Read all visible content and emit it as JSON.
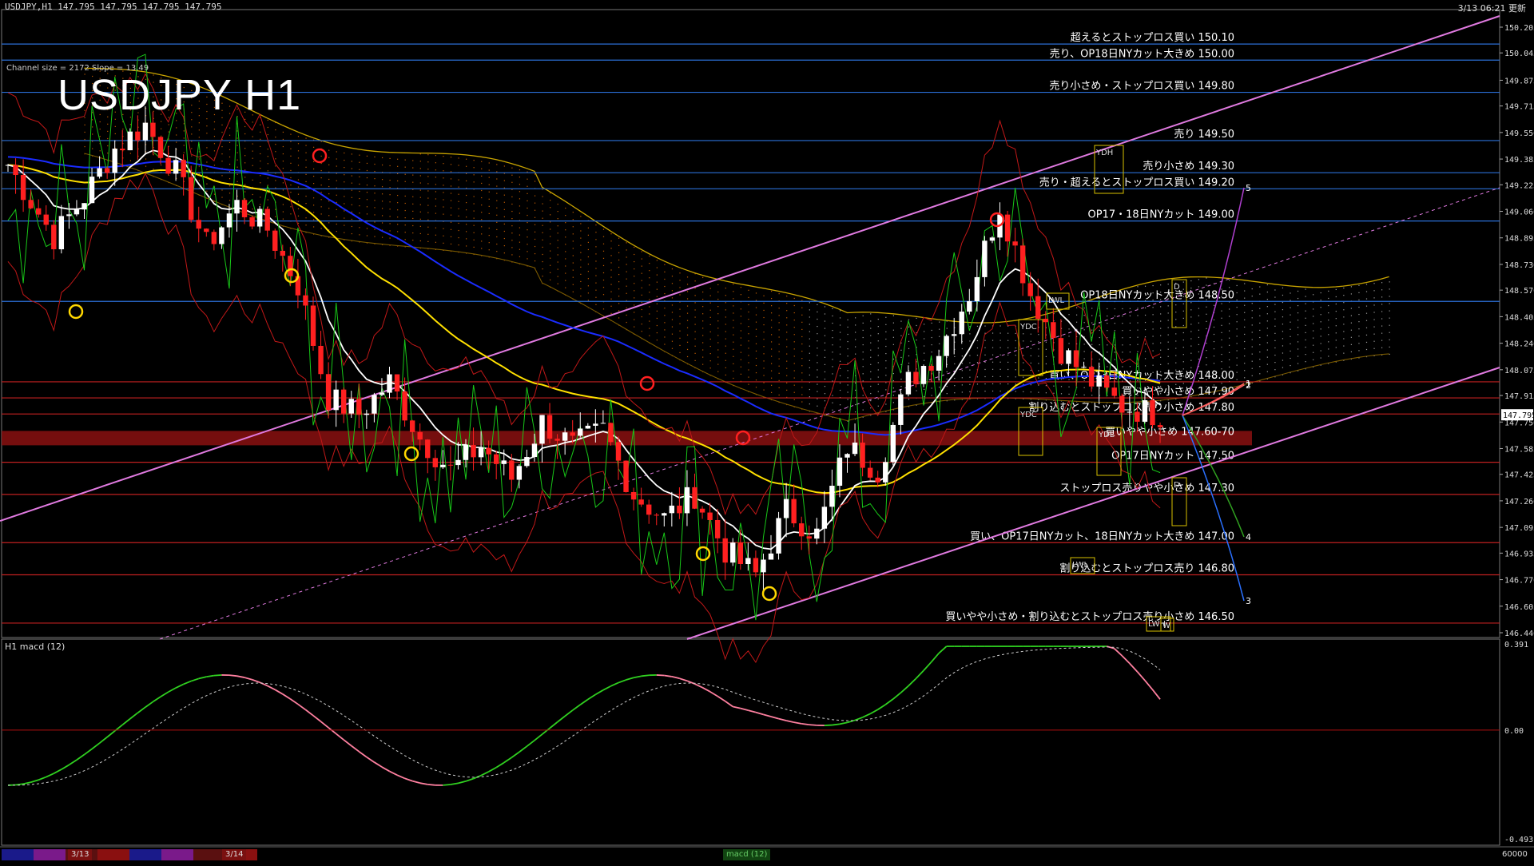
{
  "header": {
    "symbol_line": "USDJPY,H1  147.795 147.795 147.795 147.795",
    "time_line": "3/13 06:21 更新",
    "big_title": "USDJPY H1",
    "channel_info": "Channel size = 2172  Slope = 13.49",
    "macd_title": "H1  macd (12)"
  },
  "colors": {
    "background": "#000000",
    "candle_up": "#ffffff",
    "candle_down": "#ff2020",
    "blue_lines": "#2b6fd6",
    "red_lines": "#c02020",
    "channel": "#e07ae0",
    "ma_yellow": "#ffe000",
    "ma_blue": "#1a2cff",
    "ma_white": "#ffffff",
    "macd_line_up": "#30d020",
    "macd_line_down": "#ff80a0",
    "signal": "#cccccc",
    "cloud_orange": "#ff7a00"
  },
  "chart_data": {
    "type": "candlestick",
    "symbol": "USDJPY",
    "timeframe": "H1",
    "last_price": 147.795,
    "price_axis_ticks": [
      "150.205",
      "150.045",
      "149.875",
      "149.715",
      "149.550",
      "149.385",
      "149.225",
      "149.060",
      "148.895",
      "148.730",
      "148.570",
      "148.405",
      "148.240",
      "148.075",
      "147.915",
      "147.750",
      "147.585",
      "147.425",
      "147.260",
      "147.095",
      "146.935",
      "146.770",
      "146.605",
      "146.440"
    ],
    "price_range": [
      146.44,
      150.205
    ],
    "levels": [
      {
        "price": 150.1,
        "label": "超えるとストップロス買い 150.10",
        "color": "blue"
      },
      {
        "price": 150.0,
        "label": "売り、OP18日NYカット大きめ 150.00",
        "color": "blue"
      },
      {
        "price": 149.8,
        "label": "売り小さめ・ストップロス買い 149.80",
        "color": "blue"
      },
      {
        "price": 149.5,
        "label": "売り 149.50",
        "color": "blue"
      },
      {
        "price": 149.3,
        "label": "売り小さめ 149.30",
        "color": "blue"
      },
      {
        "price": 149.2,
        "label": "売り・超えるとストップロス買い 149.20",
        "color": "blue"
      },
      {
        "price": 149.0,
        "label": "OP17・18日NYカット 149.00",
        "color": "blue"
      },
      {
        "price": 148.5,
        "label": "OP18日NYカット大きめ 148.50",
        "color": "blue"
      },
      {
        "price": 148.0,
        "label": "買い、OP13日NYカット大きめ 148.00",
        "color": "red"
      },
      {
        "price": 147.9,
        "label": "買いやや小さめ 147.90",
        "color": "red"
      },
      {
        "price": 147.8,
        "label": "割り込むとストップロス売り小さめ 147.80",
        "color": "red"
      },
      {
        "price": 147.65,
        "label": "買いやや小さめ 147.60-70",
        "color": "red"
      },
      {
        "price": 147.5,
        "label": "OP17日NYカット 147.50",
        "color": "red"
      },
      {
        "price": 147.3,
        "label": "ストップロス売りやや小さめ 147.30",
        "color": "red"
      },
      {
        "price": 147.0,
        "label": "買い、OP17日NYカット、18日NYカット大きめ 147.00",
        "color": "red"
      },
      {
        "price": 146.8,
        "label": "割り込むとストップロス売り 146.80",
        "color": "red"
      },
      {
        "price": 146.5,
        "label": "買いやや小さめ・割り込むとストップロス売り小さめ 146.50",
        "color": "red"
      }
    ],
    "markers": [
      "YDC",
      "YDC",
      "YDH",
      "YDL",
      "LWL",
      "LWL",
      "LWH",
      "D",
      "D",
      "W"
    ],
    "projection_labels": [
      "5",
      "4",
      "3",
      "2",
      "1"
    ],
    "macd": {
      "axis_ticks": [
        "0.391",
        "0.00",
        "-0.493"
      ],
      "range": [
        -0.493,
        0.391
      ]
    },
    "date_labels": [
      "3/13",
      "3/14"
    ]
  },
  "bottom_bar": {
    "tab_1": "3/13",
    "tab_2": "3/14",
    "status": "macd (12)",
    "right_value": "60000"
  }
}
